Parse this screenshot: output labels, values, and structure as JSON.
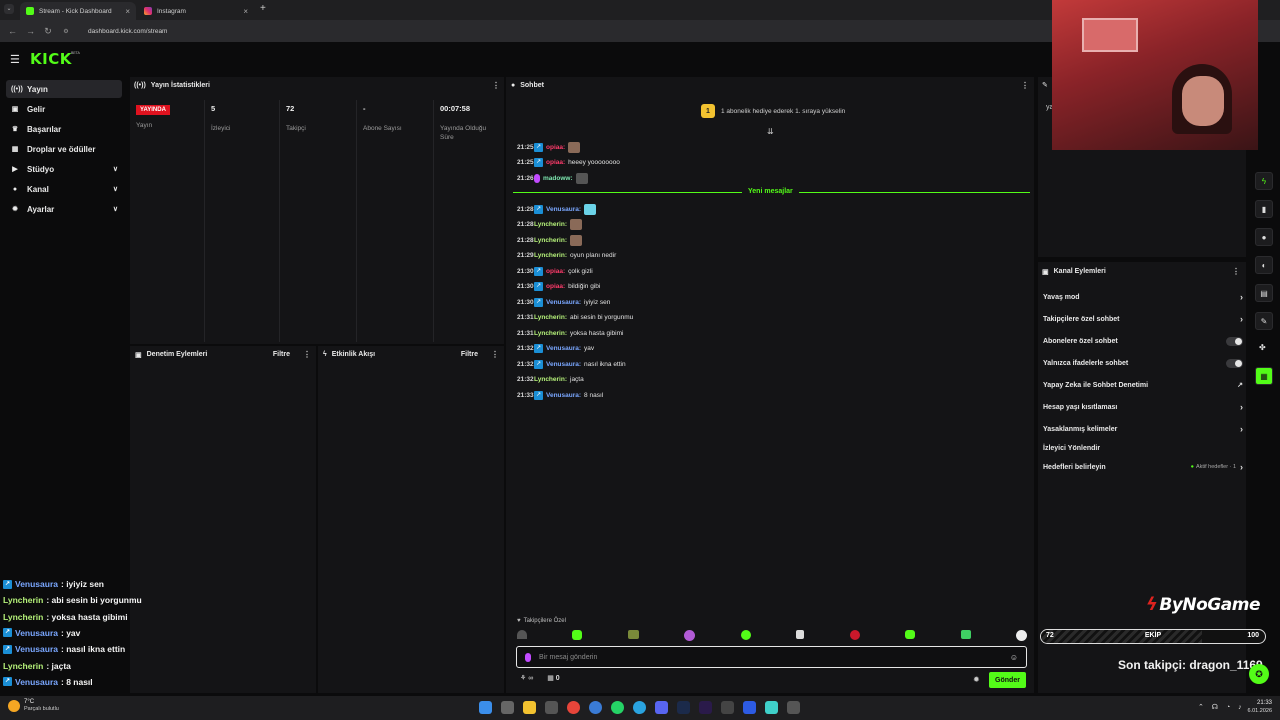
{
  "browser": {
    "tabs": [
      {
        "title": "Stream - Kick Dashboard",
        "active": true
      },
      {
        "title": "Instagram",
        "active": false
      }
    ],
    "url": "dashboard.kick.com/stream"
  },
  "app": {
    "logo": "KICK",
    "logo_badge": "BETA"
  },
  "sidebar": {
    "items": [
      {
        "label": "Yayın",
        "icon": "broadcast-icon",
        "active": true
      },
      {
        "label": "Gelir",
        "icon": "dollar-icon"
      },
      {
        "label": "Başarılar",
        "icon": "trophy-icon"
      },
      {
        "label": "Droplar ve ödüller",
        "icon": "gift-icon"
      },
      {
        "label": "Stüdyo",
        "icon": "video-icon"
      },
      {
        "label": "Kanal",
        "icon": "person-icon"
      },
      {
        "label": "Ayarlar",
        "icon": "gear-icon"
      }
    ]
  },
  "stats": {
    "title": "Yayın İstatistikleri",
    "columns": [
      {
        "value": "YAYINDA",
        "label": "Yayın"
      },
      {
        "value": "5",
        "label": "İzleyici"
      },
      {
        "value": "72",
        "label": "Takipçi"
      },
      {
        "value": "-",
        "label": "Abone Sayısı"
      },
      {
        "value": "00:07:58",
        "label": "Yayında Olduğu Süre"
      }
    ]
  },
  "moderation": {
    "title": "Denetim Eylemleri",
    "filter": "Filtre"
  },
  "activity": {
    "title": "Etkinlik Akışı",
    "filter": "Filtre"
  },
  "chat": {
    "title": "Sohbet",
    "promo_count": "1",
    "promo": "1 abonelik hediye ederek 1. sıraya yükselin",
    "new_messages": "Yeni mesajlar",
    "followers_only": "Takipçilere Özel",
    "input_placeholder": "Bir mesaj gönderin",
    "points": "0",
    "send": "Gönder",
    "messages_before": [
      {
        "time": "21:25",
        "user": "opiaa",
        "text": "",
        "color": "red",
        "emote": true
      },
      {
        "time": "21:25",
        "user": "opiaa",
        "text": "heeey yoooooooo",
        "color": "red"
      },
      {
        "time": "21:26",
        "user": "madoww",
        "text": "",
        "color": "mint",
        "emote": true
      }
    ],
    "messages_after": [
      {
        "time": "21:28",
        "user": "Venusaura",
        "text": "",
        "color": "blue",
        "emote": true
      },
      {
        "time": "21:28",
        "user": "Lyncherin",
        "text": "",
        "color": "green",
        "emote": true
      },
      {
        "time": "21:28",
        "user": "Lyncherin",
        "text": "",
        "color": "green",
        "emote": true
      },
      {
        "time": "21:29",
        "user": "Lyncherin",
        "text": "oyun planı nedir",
        "color": "green"
      },
      {
        "time": "21:30",
        "user": "opiaa",
        "text": "çolk gizli",
        "color": "red"
      },
      {
        "time": "21:30",
        "user": "opiaa",
        "text": "bildiğin gibi",
        "color": "red"
      },
      {
        "time": "21:30",
        "user": "Venusaura",
        "text": "iyiyiz sen",
        "color": "blue"
      },
      {
        "time": "21:31",
        "user": "Lyncherin",
        "text": "abi sesin bi yorgunmu",
        "color": "green"
      },
      {
        "time": "21:31",
        "user": "Lyncherin",
        "text": "yoksa hasta gibimi",
        "color": "green"
      },
      {
        "time": "21:32",
        "user": "Venusaura",
        "text": "yav",
        "color": "blue"
      },
      {
        "time": "21:32",
        "user": "Venusaura",
        "text": "nasıl ikna ettin",
        "color": "blue"
      },
      {
        "time": "21:32",
        "user": "Lyncherin",
        "text": "jaçta",
        "color": "green"
      },
      {
        "time": "21:33",
        "user": "Venusaura",
        "text": "8 nasıl",
        "color": "blue"
      }
    ]
  },
  "channel_actions": {
    "title": "Kanal Eylemleri",
    "items": [
      {
        "label": "Yavaş mod",
        "control": "chevron"
      },
      {
        "label": "Takipçilere özel sohbet",
        "control": "chevron"
      },
      {
        "label": "Abonelere özel sohbet",
        "control": "toggle"
      },
      {
        "label": "Yalnızca ifadelerle sohbet",
        "control": "toggle"
      },
      {
        "label": "Yapay Zeka ile Sohbet Denetimi",
        "control": "external"
      },
      {
        "label": "Hesap yaşı kısıtlaması",
        "control": "chevron"
      },
      {
        "label": "Yasaklanmış kelimeler",
        "control": "chevron"
      },
      {
        "label": "İzleyici Yönlendir",
        "control": "none"
      },
      {
        "label": "Hedefleri belirleyin",
        "control": "chevron",
        "extra": "Aktif hedefler · 1"
      }
    ]
  },
  "overlay": {
    "brand": "ByNoGame",
    "goal_current": "72",
    "goal_label": "EKİP",
    "goal_target": "100",
    "goal_progress": 0.72,
    "last_follower": "Son takipçi: dragon_1169",
    "chat": [
      {
        "user": "Venusaura",
        "text": " : iyiyiz sen",
        "color": "blue"
      },
      {
        "user": "Lyncherin",
        "text": " : abi sesin bi yorgunmu",
        "color": "green"
      },
      {
        "user": "Lyncherin",
        "text": " : yoksa hasta gibimi",
        "color": "green"
      },
      {
        "user": "Venusaura",
        "text": " : yav",
        "color": "blue"
      },
      {
        "user": "Venusaura",
        "text": " : nasıl ikna ettin",
        "color": "blue"
      },
      {
        "user": "Lyncherin",
        "text": " : jaçta",
        "color": "green"
      },
      {
        "user": "Venusaura",
        "text": " : 8 nasıl",
        "color": "blue"
      }
    ]
  },
  "taskbar": {
    "weather_temp": "7°C",
    "weather_desc": "Parçalı bulutlu",
    "time": "21:33",
    "date": "6.01.2026"
  },
  "colors": {
    "accent": "#53fc18",
    "live": "#e0121f",
    "panel": "#141416"
  }
}
